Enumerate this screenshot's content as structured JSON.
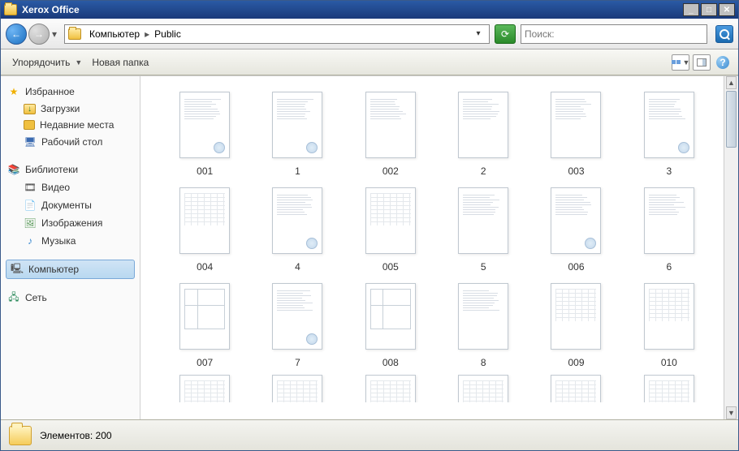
{
  "window": {
    "title": "Xerox Office"
  },
  "breadcrumb": {
    "root": "Компьютер",
    "path2": "Public"
  },
  "search": {
    "prefix": "Поиск:"
  },
  "toolbar": {
    "organize": "Упорядочить",
    "newfolder": "Новая папка"
  },
  "sidebar": {
    "favorites": "Избранное",
    "downloads": "Загрузки",
    "recent": "Недавние места",
    "desktop": "Рабочий стол",
    "libraries": "Библиотеки",
    "video": "Видео",
    "documents": "Документы",
    "images": "Изображения",
    "music": "Музыка",
    "computer": "Компьютер",
    "network": "Сеть"
  },
  "files": {
    "row1": [
      "001",
      "1",
      "002",
      "2",
      "003",
      "3"
    ],
    "row2": [
      "004",
      "4",
      "005",
      "5",
      "006",
      "6"
    ],
    "row3": [
      "007",
      "7",
      "008",
      "8",
      "009",
      "010"
    ]
  },
  "status": {
    "count_label": "Элементов:",
    "count_value": "200"
  }
}
